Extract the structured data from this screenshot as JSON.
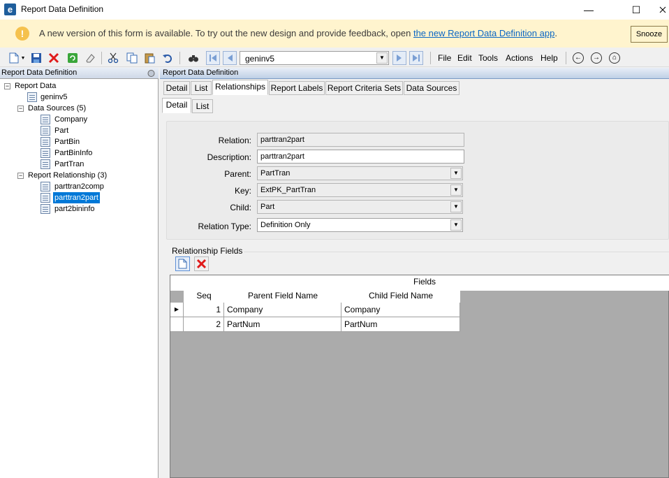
{
  "window": {
    "app_icon": "e",
    "title": "Report Data Definition",
    "minimize": "—",
    "maximize": "☐",
    "close": "✕"
  },
  "banner": {
    "text": "A new version of this form is available. To try out the new design and provide feedback, open ",
    "link": "the new Report Data Definition app",
    "suffix": ".",
    "snooze": "Snooze",
    "icon": "!"
  },
  "toolbar": {
    "combo_value": "geninv5",
    "menus": [
      "File",
      "Edit",
      "Tools",
      "Actions",
      "Help"
    ]
  },
  "left_panel": {
    "header": "Report Data Definition",
    "tree": {
      "root": "Report Data",
      "geninv": "geninv5",
      "data_sources": "Data Sources (5)",
      "ds_items": [
        "Company",
        "Part",
        "PartBin",
        "PartBinInfo",
        "PartTran"
      ],
      "relationships": "Report Relationship (3)",
      "rel_items": [
        "parttran2comp",
        "parttran2part",
        "part2bininfo"
      ]
    }
  },
  "right_panel": {
    "header": "Report Data Definition",
    "tabs": [
      "Detail",
      "List",
      "Relationships",
      "Report Labels",
      "Report Criteria Sets",
      "Data Sources"
    ],
    "sub_tabs": [
      "Detail",
      "List"
    ],
    "form": {
      "relation_label": "Relation:",
      "relation_value": "parttran2part",
      "description_label": "Description:",
      "description_value": "parttran2part",
      "parent_label": "Parent:",
      "parent_value": "PartTran",
      "key_label": "Key:",
      "key_value": "ExtPK_PartTran",
      "child_label": "Child:",
      "child_value": "Part",
      "relation_type_label": "Relation Type:",
      "relation_type_value": "Definition Only"
    },
    "relationship_fields": {
      "group_label": "Relationship Fields",
      "band": "Fields",
      "columns": [
        "Seq",
        "Parent Field Name",
        "Child Field Name"
      ],
      "rows": [
        {
          "seq": "1",
          "parent": "Company",
          "child": "Company"
        },
        {
          "seq": "2",
          "parent": "PartNum",
          "child": "PartNum"
        }
      ]
    }
  }
}
